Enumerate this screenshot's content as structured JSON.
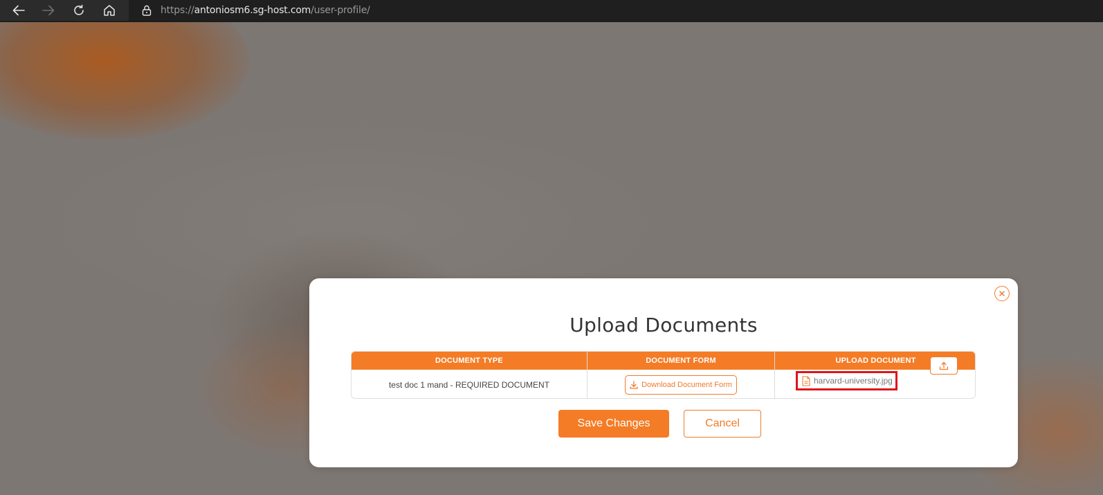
{
  "browser": {
    "url_scheme": "https://",
    "url_host": "antoniosm6.sg-host.com",
    "url_path": "/user-profile/"
  },
  "modal": {
    "title": "Upload Documents",
    "close_icon": "close-icon",
    "table": {
      "headers": [
        "DOCUMENT TYPE",
        "DOCUMENT FORM",
        "UPLOAD DOCUMENT"
      ],
      "rows": [
        {
          "document_type": "test doc 1 mand - REQUIRED DOCUMENT",
          "download_label": "Download Document Form",
          "uploaded_file": "harvard-university.jpg"
        }
      ]
    },
    "save_label": "Save Changes",
    "cancel_label": "Cancel"
  },
  "colors": {
    "accent": "#f47c26",
    "highlight": "#e0131a",
    "browser_bar": "#2b2b2b"
  }
}
